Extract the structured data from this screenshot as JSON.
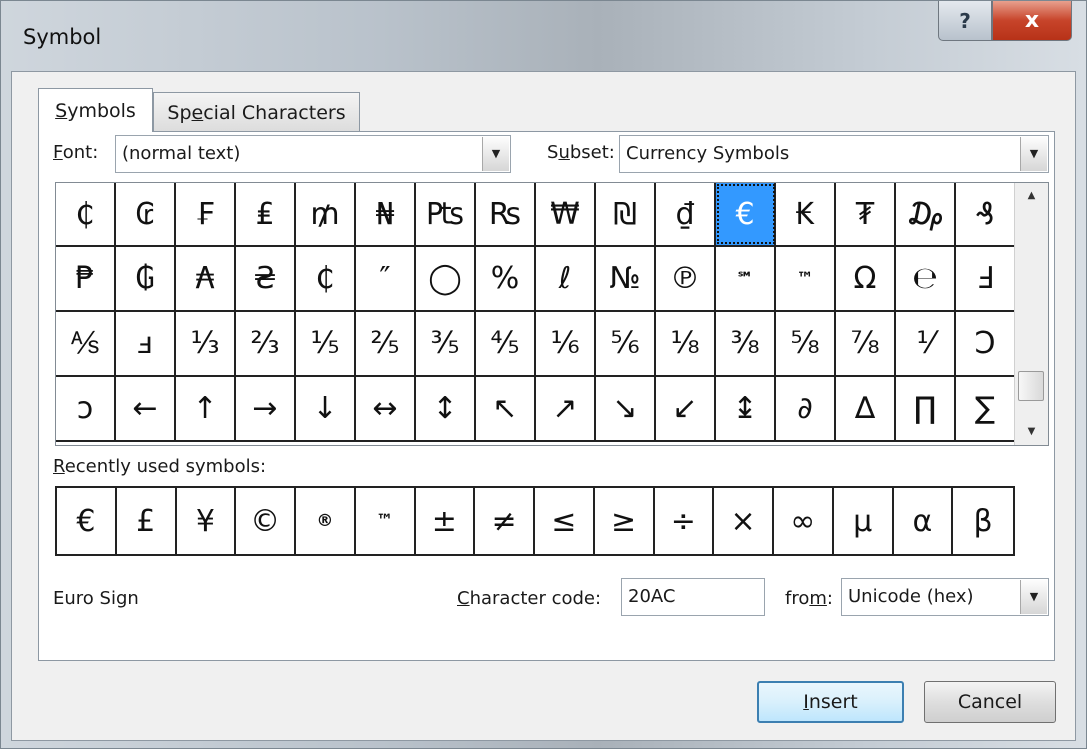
{
  "window": {
    "title": "Symbol",
    "help_glyph": "?",
    "close_glyph": "x"
  },
  "tabs": [
    {
      "label": "Symbols",
      "accel_index": 0,
      "active": true
    },
    {
      "label": "Special Characters",
      "accel_index": 2,
      "active": false
    }
  ],
  "font": {
    "label": "Font:",
    "value": "(normal text)"
  },
  "subset": {
    "label": "Subset:",
    "value": "Currency Symbols"
  },
  "symbols": [
    [
      "₵",
      "₢",
      "₣",
      "₤",
      "₥",
      "₦",
      "₧",
      "₨",
      "₩",
      "₪",
      "₫",
      "€",
      "₭",
      "₮",
      "₯",
      "₰"
    ],
    [
      "₱",
      "₲",
      "₳",
      "₴",
      "₵",
      "″",
      "◯",
      "%",
      "ℓ",
      "№",
      "℗",
      "℠",
      "™",
      "Ω",
      "℮",
      "Ⅎ"
    ],
    [
      "⅍",
      "ⅎ",
      "⅓",
      "⅔",
      "⅕",
      "⅖",
      "⅗",
      "⅘",
      "⅙",
      "⅚",
      "⅛",
      "⅜",
      "⅝",
      "⅞",
      "⅟",
      "Ↄ"
    ],
    [
      "ↄ",
      "←",
      "↑",
      "→",
      "↓",
      "↔",
      "↕",
      "↖",
      "↗",
      "↘",
      "↙",
      "↨",
      "∂",
      "∆",
      "∏",
      "∑"
    ]
  ],
  "selected_symbol": "€",
  "recent": {
    "label": "Recently used symbols:",
    "items": [
      "€",
      "£",
      "¥",
      "©",
      "®",
      "™",
      "±",
      "≠",
      "≤",
      "≥",
      "÷",
      "×",
      "∞",
      "µ",
      "α",
      "β"
    ]
  },
  "char_name": "Euro Sign",
  "char_code": {
    "label": "Character code:",
    "value": "20AC"
  },
  "from": {
    "label": "from:",
    "value": "Unicode (hex)"
  },
  "buttons": {
    "insert": "Insert",
    "cancel": "Cancel"
  },
  "colors": {
    "selection": "#3399ff",
    "default_button_border": "#3c7fb1",
    "close_button": "#c7442a"
  }
}
